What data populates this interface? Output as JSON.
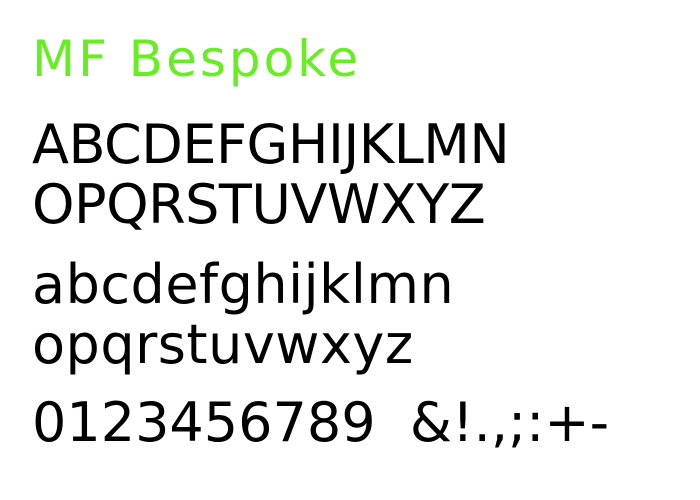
{
  "title": "MF Bespoke",
  "uppercase_line_1": "ABCDEFGHIJKLMN",
  "uppercase_line_2": "OPQRSTUVWXYZ",
  "lowercase_line_1": "abcdefghijklmn",
  "lowercase_line_2": "opqrstuvwxyz",
  "digits_and_symbols": "0123456789  &!.,;:+-",
  "colors": {
    "title": "#66ee22",
    "glyphs": "#000000",
    "background": "#ffffff"
  }
}
